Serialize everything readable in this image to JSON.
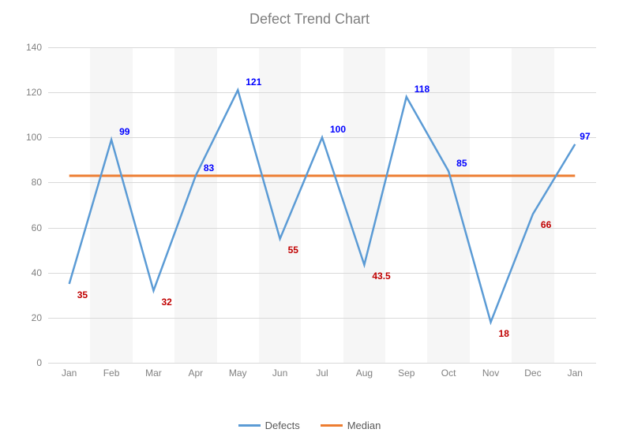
{
  "chart_data": {
    "type": "line",
    "title": "Defect Trend Chart",
    "xlabel": "",
    "ylabel": "",
    "ylim": [
      0,
      140
    ],
    "yticks": [
      0,
      20,
      40,
      60,
      80,
      100,
      120,
      140
    ],
    "categories": [
      "Jan",
      "Feb",
      "Mar",
      "Apr",
      "May",
      "Jun",
      "Jul",
      "Aug",
      "Sep",
      "Oct",
      "Nov",
      "Dec",
      "Jan"
    ],
    "series": [
      {
        "name": "Defects",
        "color": "#5b9bd5",
        "values": [
          35,
          99,
          32,
          83,
          121,
          55,
          100,
          43.5,
          118,
          85,
          18,
          66,
          97
        ]
      },
      {
        "name": "Median",
        "color": "#ed7d31",
        "values": [
          83,
          83,
          83,
          83,
          83,
          83,
          83,
          83,
          83,
          83,
          83,
          83,
          83
        ]
      }
    ],
    "median_threshold": 83,
    "data_labels": [
      {
        "i": 0,
        "text": "35",
        "side": "below"
      },
      {
        "i": 1,
        "text": "99",
        "side": "above"
      },
      {
        "i": 2,
        "text": "32",
        "side": "below"
      },
      {
        "i": 3,
        "text": "83",
        "side": "above"
      },
      {
        "i": 4,
        "text": "121",
        "side": "above"
      },
      {
        "i": 5,
        "text": "55",
        "side": "below"
      },
      {
        "i": 6,
        "text": "100",
        "side": "above"
      },
      {
        "i": 7,
        "text": "43.5",
        "side": "below"
      },
      {
        "i": 8,
        "text": "118",
        "side": "above"
      },
      {
        "i": 9,
        "text": "85",
        "side": "above"
      },
      {
        "i": 10,
        "text": "18",
        "side": "below"
      },
      {
        "i": 11,
        "text": "66",
        "side": "below"
      },
      {
        "i": 12,
        "text": "97",
        "side": "above"
      }
    ],
    "legend_position": "bottom"
  }
}
